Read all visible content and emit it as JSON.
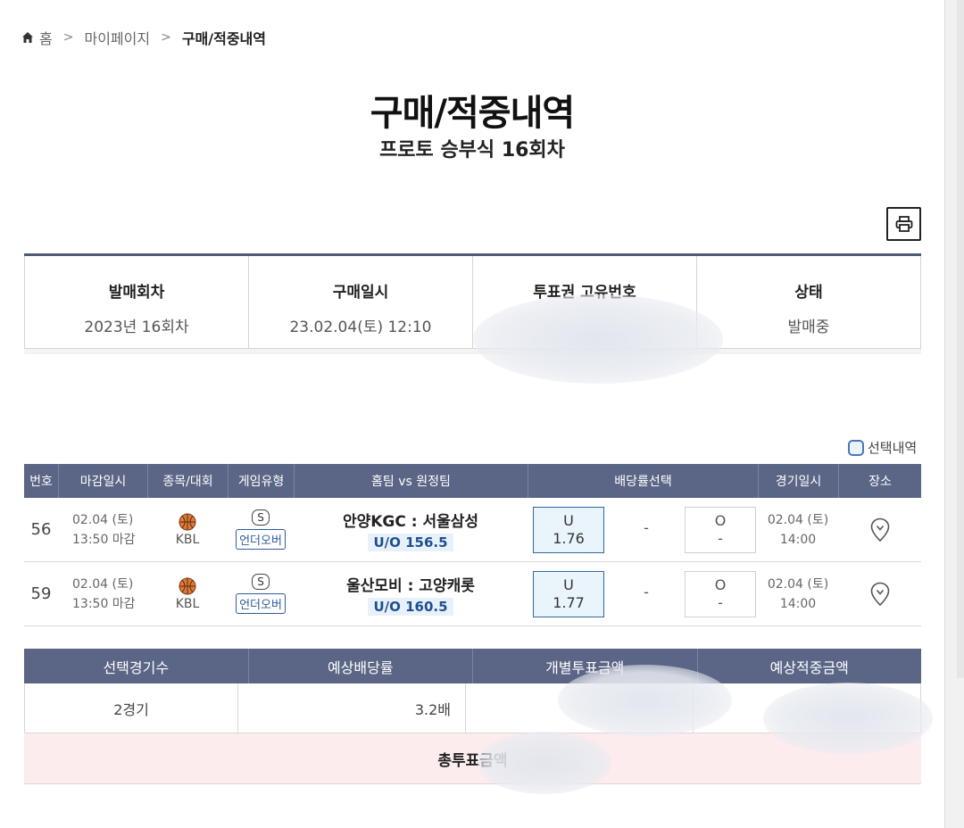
{
  "breadcrumb": {
    "home": "홈",
    "sep": ">",
    "mypage": "마이페이지",
    "current": "구매/적중내역"
  },
  "title": "구매/적중내역",
  "subtitle": "프로토 승부식 16회차",
  "info": {
    "round_label": "발매회차",
    "round_value": "2023년 16회차",
    "purchase_label": "구매일시",
    "purchase_value": "23.02.04(토) 12:10",
    "ticket_label": "투표권 고유번호",
    "ticket_value": "",
    "status_label": "상태",
    "status_value": "발매중"
  },
  "select_legend": "선택내역",
  "games_header": [
    "번호",
    "마감일시",
    "종목/대회",
    "게임유형",
    "홈팀 vs 원정팀",
    "배당률선택",
    "경기일시",
    "장소"
  ],
  "games": [
    {
      "no": "56",
      "deadline_date": "02.04 (토)",
      "deadline_time": "13:50 마감",
      "league": "KBL",
      "type_symbol": "S",
      "type_label": "언더오버",
      "teams": "안양KGC : 서울삼성",
      "uo": "U/O 156.5",
      "u_label": "U",
      "u_odds": "1.76",
      "dash": "-",
      "o_label": "O",
      "o_odds": "-",
      "game_date": "02.04 (토)",
      "game_time": "14:00"
    },
    {
      "no": "59",
      "deadline_date": "02.04 (토)",
      "deadline_time": "13:50 마감",
      "league": "KBL",
      "type_symbol": "S",
      "type_label": "언더오버",
      "teams": "울산모비 : 고양캐롯",
      "uo": "U/O 160.5",
      "u_label": "U",
      "u_odds": "1.77",
      "dash": "-",
      "o_label": "O",
      "o_odds": "-",
      "game_date": "02.04 (토)",
      "game_time": "14:00"
    }
  ],
  "summary_header": [
    "선택경기수",
    "예상배당률",
    "개별투표금액",
    "예상적중금액"
  ],
  "summary": {
    "games": "2경기",
    "odds": "3.2배",
    "amount": "",
    "expected": ""
  },
  "total_label": "총투표금액",
  "colors": {
    "header_bg": "#5b6585",
    "accent": "#2f6aa6",
    "total_bg": "#fcecee"
  }
}
